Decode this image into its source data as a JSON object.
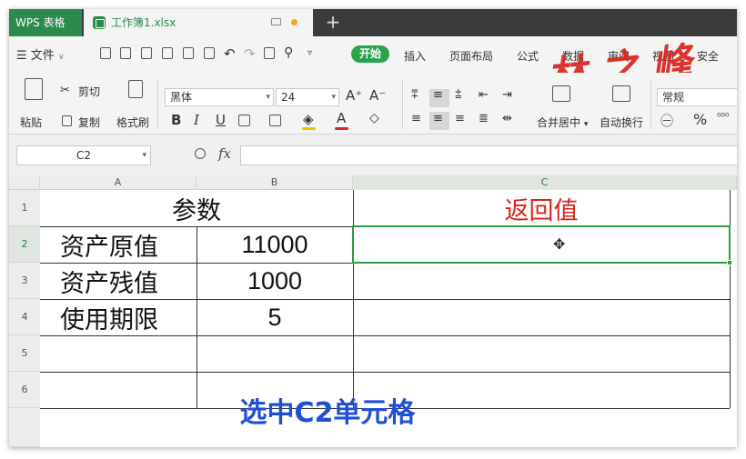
{
  "titlebar": {
    "app_tab": "WPS 表格",
    "file_tab": "工作簿1.xlsx",
    "new_tab": "+"
  },
  "menu": {
    "file": "文件",
    "start": "开始",
    "insert": "插入",
    "page_layout": "页面布局",
    "formula": "公式",
    "data": "数据",
    "review": "审阅",
    "view": "视图",
    "security": "安全"
  },
  "watermark": "林之峰",
  "ribbon": {
    "paste": "粘贴",
    "cut": "剪切",
    "copy": "复制",
    "format_painter": "格式刷",
    "font_name": "黑体",
    "font_size": "24",
    "grow_font": "A⁺",
    "shrink_font": "A⁻",
    "bold": "B",
    "italic": "I",
    "underline": "U",
    "merge_center": "合并居中",
    "wrap_text": "自动换行",
    "number_format": "常规",
    "percent": "%"
  },
  "formula_bar": {
    "name_box": "C2",
    "fx": "fx",
    "formula": ""
  },
  "grid": {
    "columns": [
      "A",
      "B",
      "C"
    ],
    "rows": [
      "1",
      "2",
      "3",
      "4",
      "5",
      "6"
    ],
    "cells": {
      "header_params": "参数",
      "header_return": "返回值",
      "r2_label": "资产原值",
      "r2_value": "11000",
      "r3_label": "资产残值",
      "r3_value": "1000",
      "r4_label": "使用期限",
      "r4_value": "5"
    }
  },
  "caption": "选中C2单元格",
  "colors": {
    "brand_green": "#2b8a4c",
    "return_red": "#d9231d",
    "caption_blue": "#1f4fd6",
    "selection_green": "#2e9d3f"
  }
}
